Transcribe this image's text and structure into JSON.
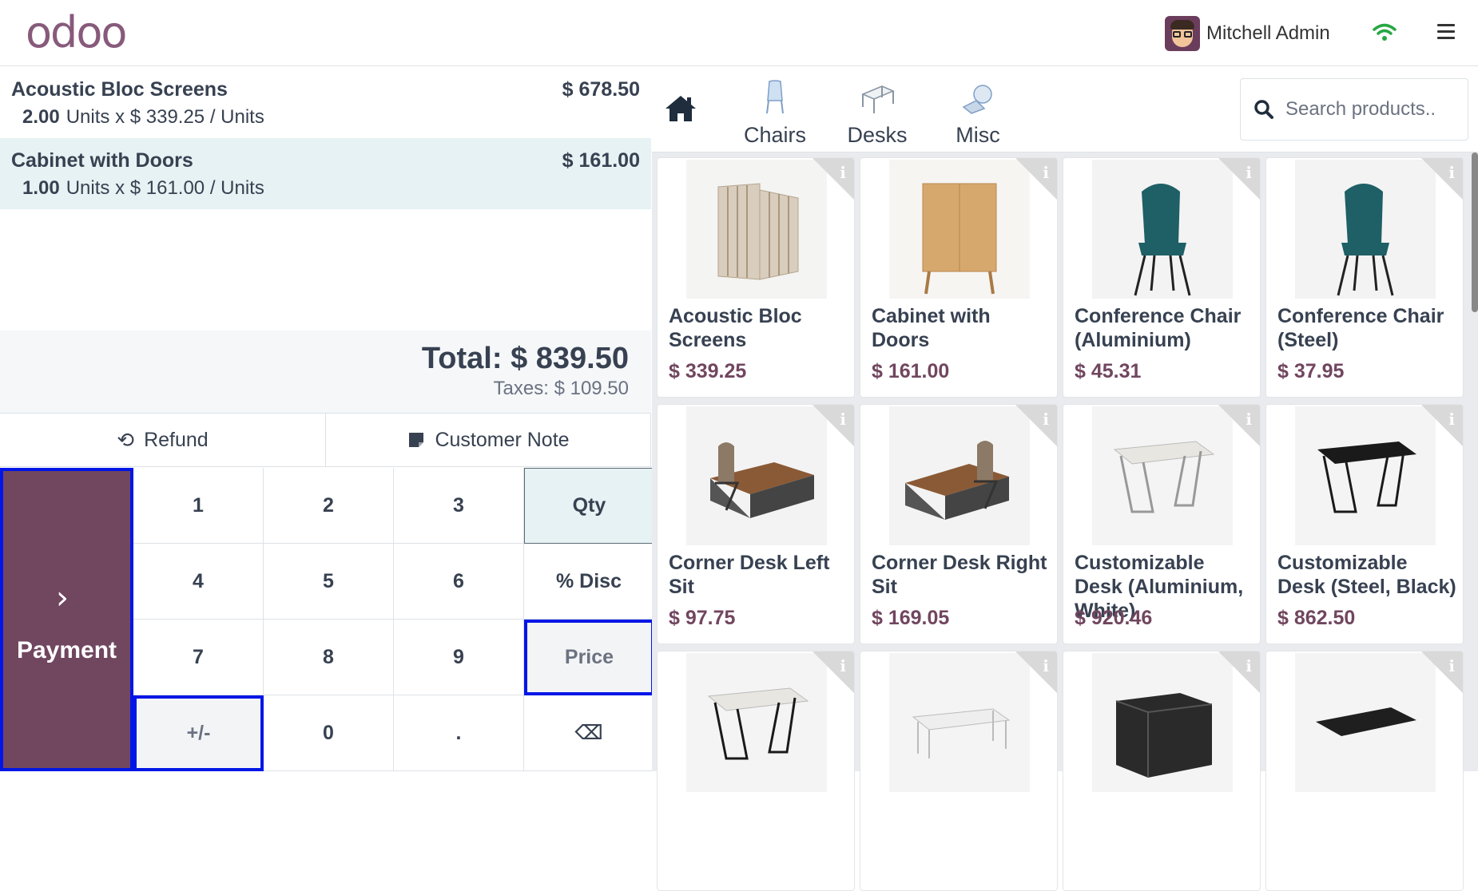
{
  "header": {
    "logo_text": "odoo",
    "user_name": "Mitchell Admin"
  },
  "order": {
    "lines": [
      {
        "name": "Acoustic Bloc Screens",
        "price": "$ 678.50",
        "qty": "2.00",
        "detail": "Units x $ 339.25 / Units"
      },
      {
        "name": "Cabinet with Doors",
        "price": "$ 161.00",
        "qty": "1.00",
        "detail": "Units x $ 161.00 / Units"
      }
    ],
    "total": "Total: $ 839.50",
    "taxes": "Taxes: $ 109.50"
  },
  "controls": {
    "refund": "Refund",
    "customer_note": "Customer Note"
  },
  "numpad": {
    "payment": "Payment",
    "keys": [
      "1",
      "2",
      "3",
      "Qty",
      "4",
      "5",
      "6",
      "% Disc",
      "7",
      "8",
      "9",
      "Price",
      "+/-",
      "0",
      ".",
      "⌫"
    ]
  },
  "categories": [
    {
      "label": "Chairs"
    },
    {
      "label": "Desks"
    },
    {
      "label": "Misc"
    }
  ],
  "search": {
    "placeholder": "Search products.."
  },
  "products": [
    {
      "name": "Acoustic Bloc Screens",
      "price": "$ 339.25"
    },
    {
      "name": "Cabinet with Doors",
      "price": "$ 161.00"
    },
    {
      "name": "Conference Chair (Aluminium)",
      "price": "$ 45.31"
    },
    {
      "name": "Conference Chair (Steel)",
      "price": "$ 37.95"
    },
    {
      "name": "Corner Desk Left Sit",
      "price": "$ 97.75"
    },
    {
      "name": "Corner Desk Right Sit",
      "price": "$ 169.05"
    },
    {
      "name": "Customizable Desk (Aluminium, White)",
      "price": "$ 920.46"
    },
    {
      "name": "Customizable Desk (Steel, Black)",
      "price": "$ 862.50"
    },
    {
      "name": "",
      "price": ""
    },
    {
      "name": "",
      "price": ""
    },
    {
      "name": "",
      "price": ""
    },
    {
      "name": "",
      "price": ""
    }
  ],
  "colors": {
    "brand": "#71465f",
    "selected_line": "#e6f2f3",
    "highlight_border": "#0016e6"
  }
}
